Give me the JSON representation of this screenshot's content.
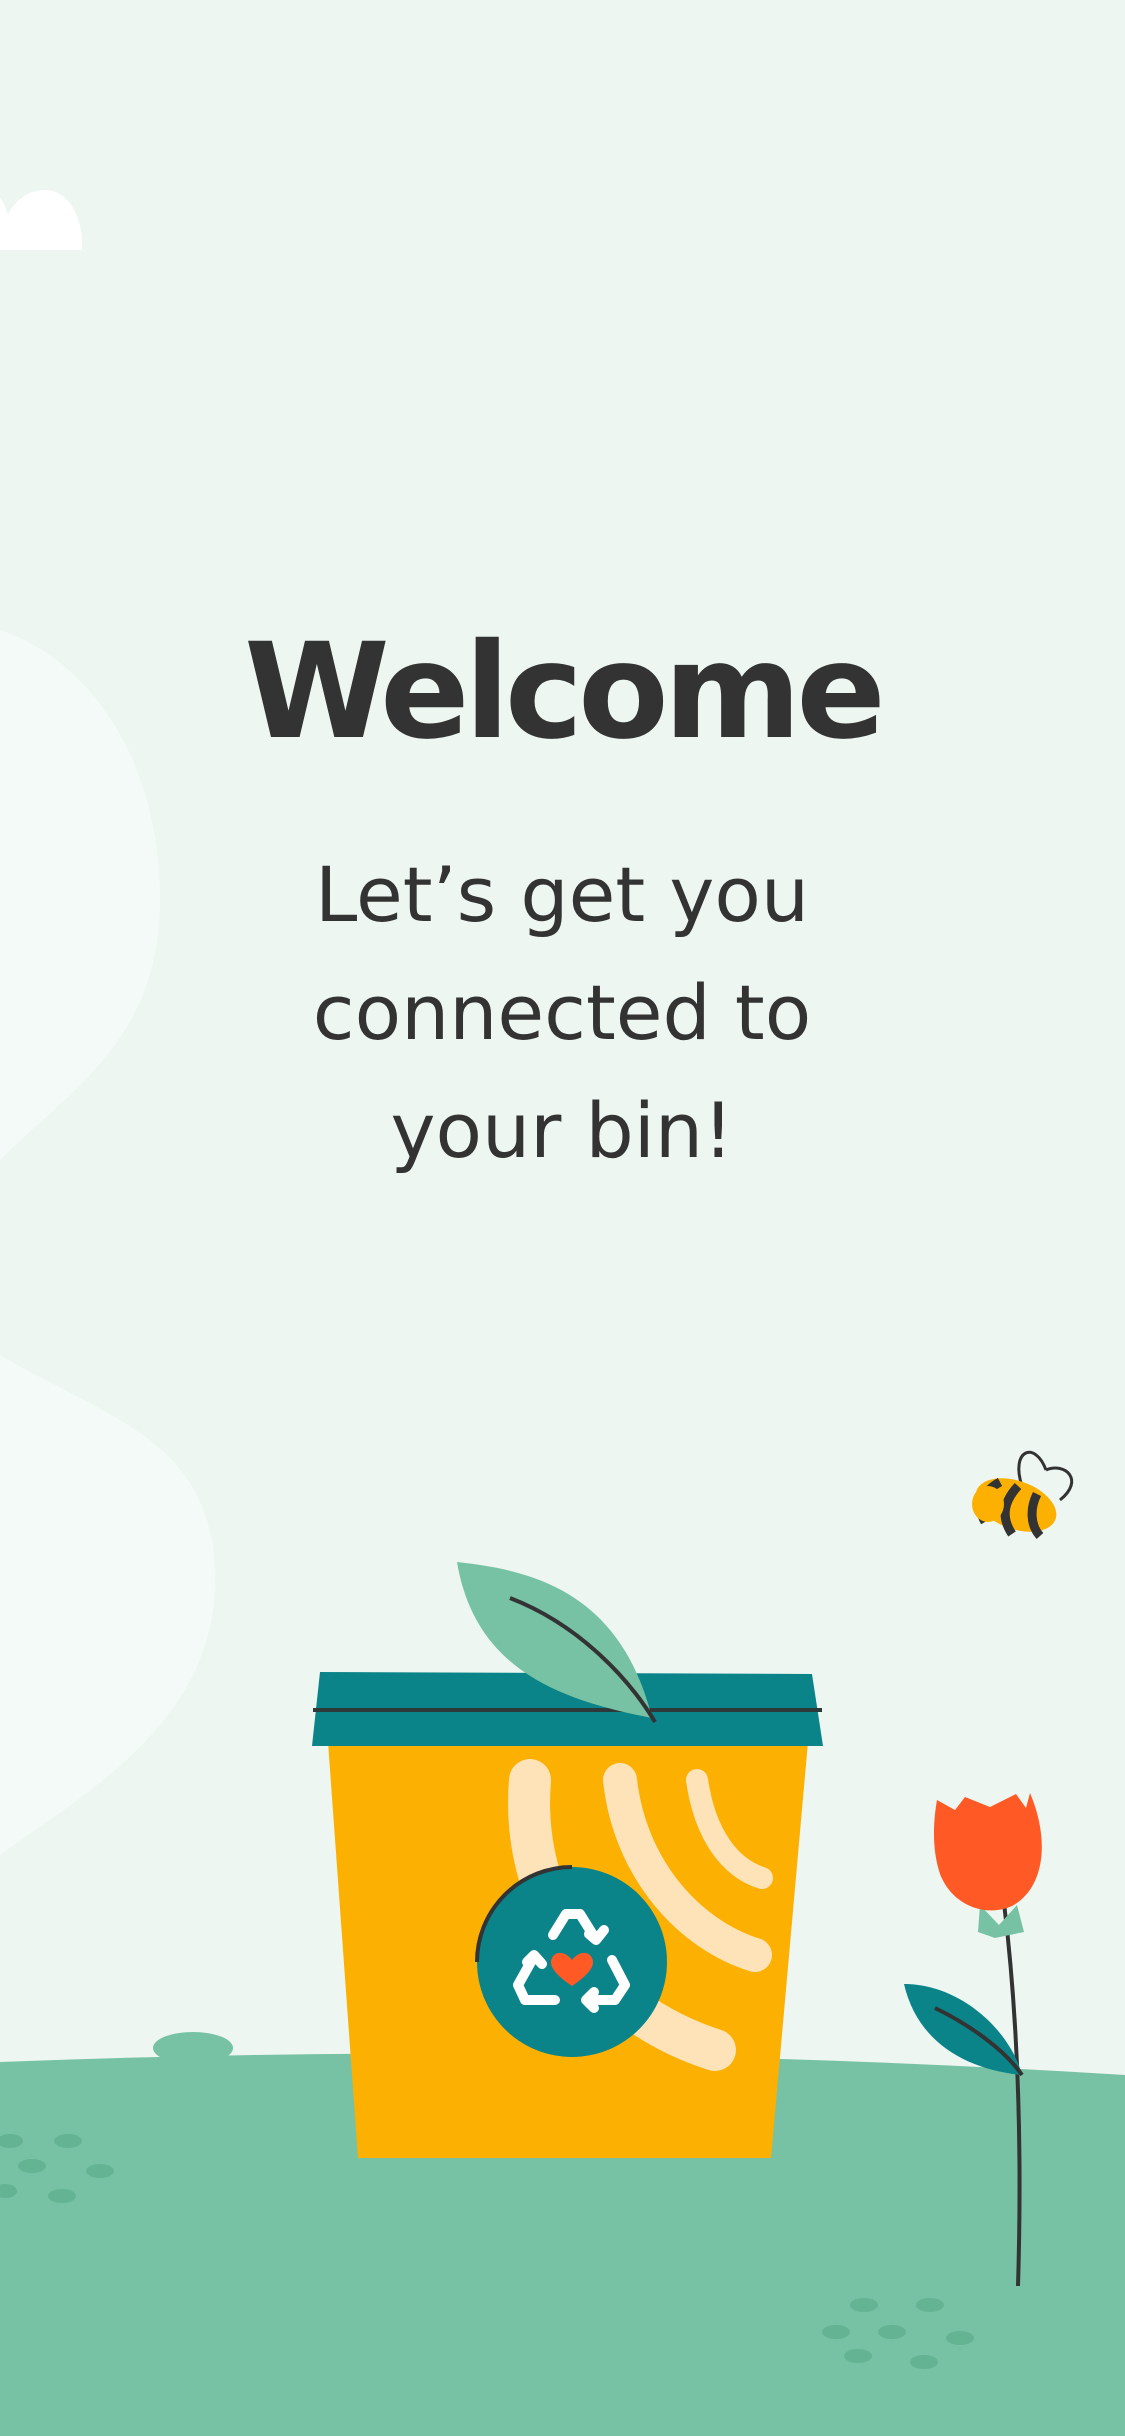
{
  "screen": {
    "title": "Welcome",
    "subtitle": "Let’s get you connected to your bin!"
  },
  "colors": {
    "background": "#EDF6F1",
    "ground": "#77C2A4",
    "text": "#333333",
    "bin_body": "#FCB002",
    "bin_lid": "#0A8489",
    "flower": "#FF5A26",
    "leaf": "#77C2A4"
  },
  "illustration": {
    "icons": [
      "cloud-icon",
      "bee-icon",
      "leaf-icon",
      "recycle-heart-icon",
      "wifi-signal-icon",
      "tulip-flower-icon"
    ]
  }
}
